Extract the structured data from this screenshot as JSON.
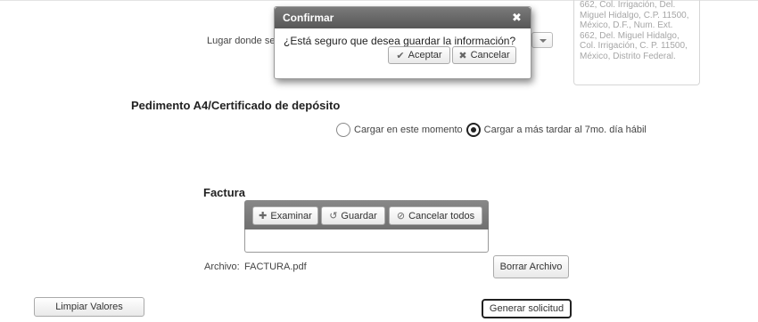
{
  "form": {
    "place_label": "Lugar donde se",
    "address_text": "662, Col. Irrigación, Del.\nMiguel Hidalgo, C.P. 11500,\nMéxico, D.F., Num. Ext.\n662, Del. Miguel Hidalgo,\nCol. Irrigación, C. P. 11500,\nMéxico, Distrito Federal.",
    "pedimento_title": "Pedimento A4/Certificado de depósito",
    "radio_now": "Cargar en este momento",
    "radio_later": "Cargar a más tardar al 7mo. día hábil",
    "radio_selected": "later",
    "factura_title": "Factura",
    "archivo_label": "Archivo:",
    "archivo_value": "FACTURA.pdf"
  },
  "upload": {
    "examinar": "Examinar",
    "guardar": "Guardar",
    "cancelar_todos": "Cancelar todos"
  },
  "buttons": {
    "borrar": "Borrar Archivo",
    "limpiar": "Limpiar Valores",
    "generar": "Generar solicitud"
  },
  "dialog": {
    "title": "Confirmar",
    "close": "✖",
    "message": "¿Está seguro que desea guardar la información?",
    "ok": "Aceptar",
    "cancel": "Cancelar"
  },
  "icons": {
    "plus": "✚",
    "undo": "↺",
    "ban": "⊘",
    "check": "✔",
    "x": "✖"
  }
}
